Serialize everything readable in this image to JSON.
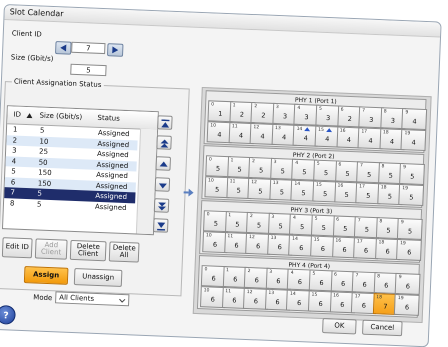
{
  "window": {
    "title": "Slot Calendar"
  },
  "client_id": {
    "label": "Client ID",
    "value": "7"
  },
  "size": {
    "label": "Size (Gbit/s)",
    "value": "5"
  },
  "assignation": {
    "label": "Client Assignation Status",
    "columns": [
      "ID",
      "Size (Gbit/s)",
      "Status"
    ],
    "rows": [
      {
        "id": "1",
        "size": "5",
        "status": "Assigned"
      },
      {
        "id": "2",
        "size": "10",
        "status": "Assigned"
      },
      {
        "id": "3",
        "size": "25",
        "status": "Assigned"
      },
      {
        "id": "4",
        "size": "50",
        "status": "Assigned"
      },
      {
        "id": "5",
        "size": "150",
        "status": "Assigned"
      },
      {
        "id": "6",
        "size": "150",
        "status": "Assigned"
      },
      {
        "id": "7",
        "size": "5",
        "status": "Assigned"
      },
      {
        "id": "8",
        "size": "5",
        "status": "Assigned"
      }
    ],
    "selected_row": 6
  },
  "side_buttons": [
    "scroll-top-icon",
    "page-up-icon",
    "up-icon",
    "down-icon",
    "page-down-icon",
    "scroll-bottom-icon"
  ],
  "actions": {
    "edit_id": "Edit ID",
    "add_client": "Add Client",
    "delete_client": "Delete Client",
    "delete_all": "Delete All",
    "assign": "Assign",
    "unassign": "Unassign"
  },
  "mode": {
    "label": "Mode",
    "value": "All Clients"
  },
  "phys": [
    {
      "label": "PHY 1 (Port 1)",
      "values": [
        "1",
        "2",
        "2",
        "3",
        "3",
        "3",
        "2",
        "3",
        "3",
        "4",
        "4",
        "4",
        "4",
        "4",
        "4",
        "4",
        "4",
        "4",
        "4",
        "4"
      ],
      "marked": [
        14,
        15
      ]
    },
    {
      "label": "PHY 2 (Port 2)",
      "values": [
        "5",
        "5",
        "5",
        "5",
        "5",
        "5",
        "5",
        "5",
        "5",
        "5",
        "5",
        "5",
        "5",
        "5",
        "5",
        "5",
        "5",
        "5",
        "5",
        "5"
      ]
    },
    {
      "label": "PHY 3 (Port 3)",
      "values": [
        "5",
        "5",
        "5",
        "5",
        "5",
        "5",
        "5",
        "5",
        "5",
        "5",
        "6",
        "6",
        "6",
        "6",
        "6",
        "6",
        "6",
        "6",
        "6",
        "6"
      ]
    },
    {
      "label": "PHY 4 (Port 4)",
      "values": [
        "6",
        "6",
        "6",
        "6",
        "6",
        "6",
        "6",
        "6",
        "6",
        "6",
        "6",
        "6",
        "6",
        "6",
        "6",
        "6",
        "6",
        "6",
        "7",
        "6"
      ],
      "highlight": 18
    }
  ],
  "dialog": {
    "ok": "OK",
    "cancel": "Cancel"
  },
  "colors": {
    "accent": "#f29a0c",
    "selection": "#1f2d6b",
    "row_alt": "#dde9f7"
  }
}
